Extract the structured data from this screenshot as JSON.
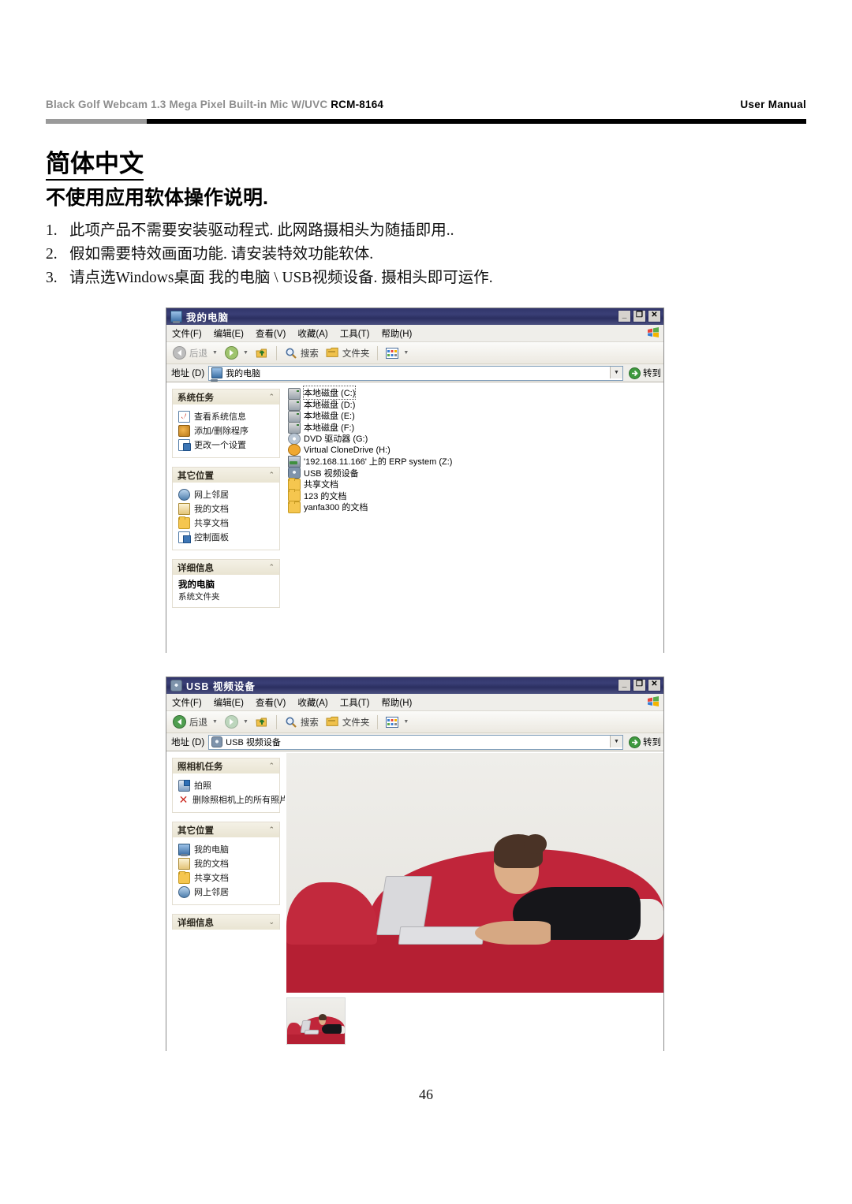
{
  "header": {
    "product": "Black  Golf  Webcam  1.3  Mega  Pixel  Built-in  Mic  W/UVC",
    "model": "RCM-8164",
    "right": "User  Manual"
  },
  "headings": {
    "language": "简体中文",
    "subtitle": "不使用应用软体操作说明."
  },
  "steps": [
    {
      "num": "1.",
      "text": "此项产品不需要安装驱动程式. 此网路摄相头为随插即用.."
    },
    {
      "num": "2.",
      "text": "假如需要特效画面功能. 请安装特效功能软体."
    },
    {
      "num": "3.",
      "text": "请点选Windows桌面 我的电脑 \\ USB视频设备. 摄相头即可运作."
    }
  ],
  "window1": {
    "title": "我的电脑",
    "title_icon": "my-computer-icon",
    "window_buttons": {
      "minimize": "_",
      "maximize": "❐",
      "close": "✕"
    },
    "menus": [
      "文件(F)",
      "编辑(E)",
      "查看(V)",
      "收藏(A)",
      "工具(T)",
      "帮助(H)"
    ],
    "toolbar": {
      "back": "后退",
      "search": "搜索",
      "folders": "文件夹"
    },
    "address": {
      "label": "地址 (D)",
      "value": "我的电脑",
      "go": "转到"
    },
    "panels": [
      {
        "title": "系统任务",
        "chevron": "⌃",
        "items": [
          {
            "label": "查看系统信息",
            "icon": "system-info-icon"
          },
          {
            "label": "添加/删除程序",
            "icon": "add-remove-programs-icon"
          },
          {
            "label": "更改一个设置",
            "icon": "change-setting-icon"
          }
        ]
      },
      {
        "title": "其它位置",
        "chevron": "⌃",
        "items": [
          {
            "label": "网上邻居",
            "icon": "network-places-icon"
          },
          {
            "label": "我的文档",
            "icon": "my-documents-icon"
          },
          {
            "label": "共享文档",
            "icon": "shared-documents-icon"
          },
          {
            "label": "控制面板",
            "icon": "control-panel-icon"
          }
        ]
      },
      {
        "title": "详细信息",
        "chevron": "⌃",
        "detail_title": "我的电脑",
        "detail_sub": "系统文件夹"
      }
    ],
    "files": [
      {
        "label": "本地磁盘 (C:)",
        "icon": "hard-drive-icon",
        "selected": true
      },
      {
        "label": "本地磁盘 (D:)",
        "icon": "hard-drive-icon",
        "selected": false
      },
      {
        "label": "本地磁盘 (E:)",
        "icon": "hard-drive-icon",
        "selected": false
      },
      {
        "label": "本地磁盘 (F:)",
        "icon": "hard-drive-icon",
        "selected": false
      },
      {
        "label": "DVD 驱动器 (G:)",
        "icon": "dvd-drive-icon",
        "selected": false
      },
      {
        "label": "Virtual CloneDrive (H:)",
        "icon": "virtual-clonedrive-icon",
        "selected": false
      },
      {
        "label": "'192.168.11.166' 上的 ERP system (Z:)",
        "icon": "network-drive-icon",
        "selected": false
      },
      {
        "label": "USB 视频设备",
        "icon": "usb-video-device-icon",
        "selected": false
      },
      {
        "label": "共享文档",
        "icon": "folder-icon",
        "selected": false
      },
      {
        "label": "123 的文档",
        "icon": "folder-icon",
        "selected": false
      },
      {
        "label": "yanfa300 的文档",
        "icon": "folder-icon",
        "selected": false
      }
    ]
  },
  "window2": {
    "title": "USB 视频设备",
    "title_icon": "usb-video-device-icon",
    "window_buttons": {
      "minimize": "_",
      "maximize": "❐",
      "close": "✕"
    },
    "menus": [
      "文件(F)",
      "编辑(E)",
      "查看(V)",
      "收藏(A)",
      "工具(T)",
      "帮助(H)"
    ],
    "toolbar": {
      "back": "后退",
      "search": "搜索",
      "folders": "文件夹"
    },
    "address": {
      "label": "地址 (D)",
      "value": "USB 视频设备",
      "go": "转到"
    },
    "panels": [
      {
        "title": "照相机任务",
        "chevron": "⌃",
        "items": [
          {
            "label": "拍照",
            "icon": "take-picture-icon"
          },
          {
            "label": "删除照相机上的所有照片",
            "icon": "delete-all-photos-icon"
          }
        ]
      },
      {
        "title": "其它位置",
        "chevron": "⌃",
        "items": [
          {
            "label": "我的电脑",
            "icon": "my-computer-icon"
          },
          {
            "label": "我的文档",
            "icon": "my-documents-icon"
          },
          {
            "label": "共享文档",
            "icon": "shared-documents-icon"
          },
          {
            "label": "网上邻居",
            "icon": "network-places-icon"
          }
        ]
      },
      {
        "title": "详细信息",
        "chevron": "⌄"
      }
    ],
    "preview": {
      "alt": "woman lying on red couch using laptop",
      "thumb_alt": "thumbnail of woman on red couch"
    }
  },
  "page_number": "46",
  "colors": {
    "titlebar": "#31356b",
    "panel_header": "#f0ecdd",
    "couch_red": "#b51f33",
    "rule_black": "#000000",
    "rule_grey": "#9a9a9a"
  }
}
